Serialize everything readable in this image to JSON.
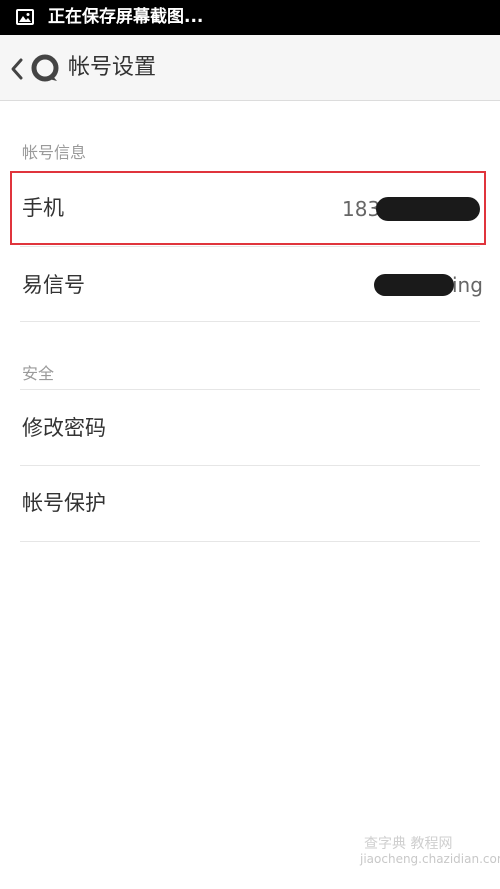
{
  "status_bar": {
    "icon": "image-icon",
    "text": "正在保存屏幕截图..."
  },
  "header": {
    "back_icon": "chevron-left-icon",
    "logo_icon": "app-logo-icon",
    "title": "帐号设置"
  },
  "sections": {
    "account_info": {
      "header": "帐号信息",
      "phone": {
        "label": "手机",
        "value_prefix": "183"
      },
      "yixin_id": {
        "label": "易信号",
        "value_suffix": "ing"
      }
    },
    "security": {
      "header": "安全",
      "change_password": {
        "label": "修改密码"
      },
      "account_protection": {
        "label": "帐号保护"
      }
    }
  },
  "colors": {
    "highlight": "#e0343c",
    "status_bar_bg": "#000000",
    "action_bar_bg": "#f6f6f6"
  },
  "watermark": {
    "line1": "查字典 教程网",
    "line2": "jiaocheng.chazidian.com"
  }
}
